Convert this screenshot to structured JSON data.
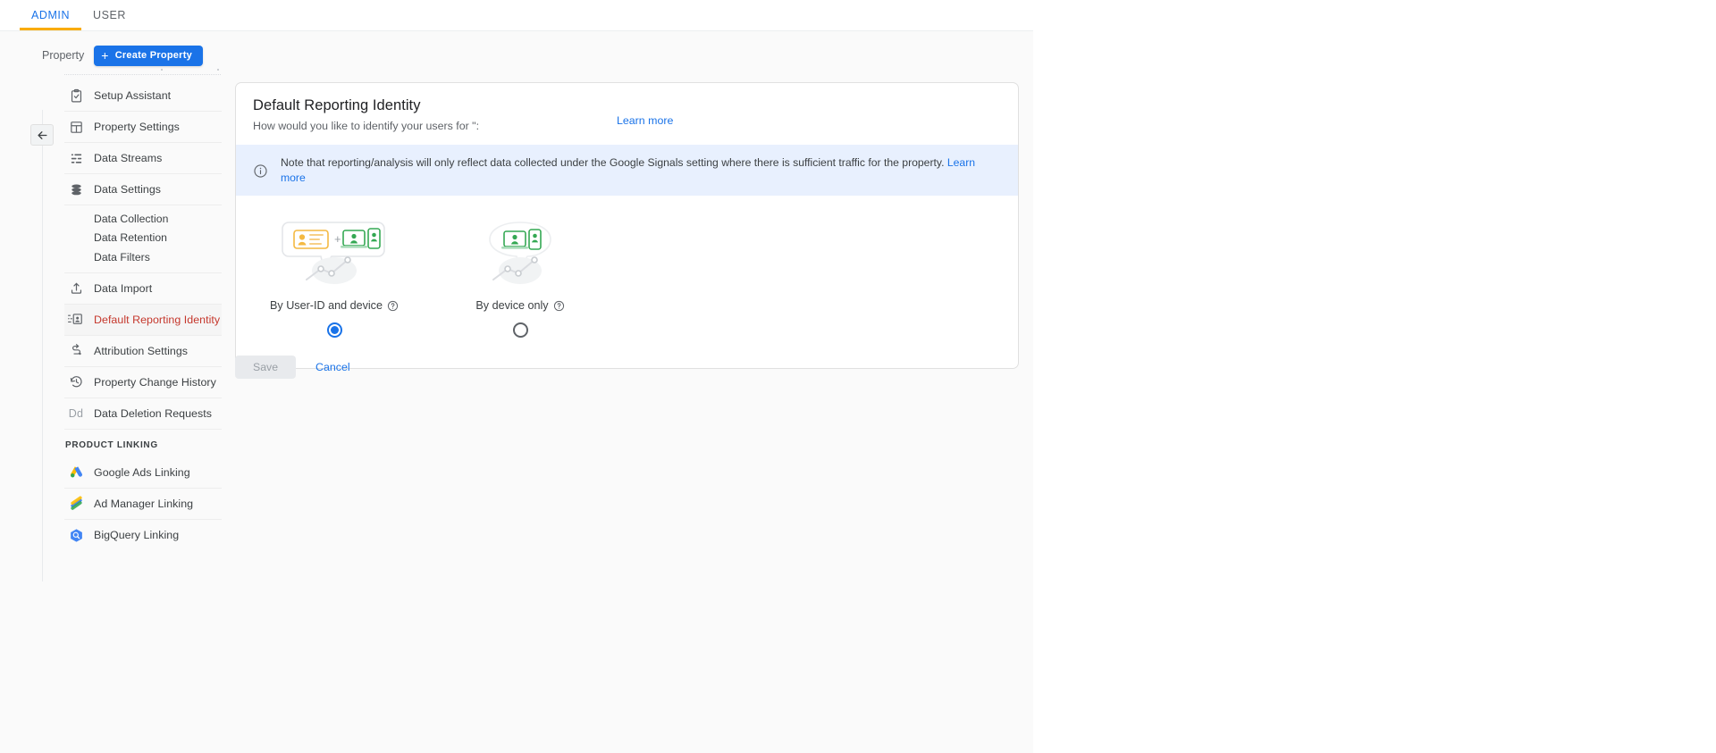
{
  "tabs": [
    {
      "label": "ADMIN",
      "active": true
    },
    {
      "label": "USER",
      "active": false
    }
  ],
  "property_bar": {
    "label": "Property",
    "create_button": "Create Property",
    "plus": "+"
  },
  "back_button": {
    "name": "back-arrow",
    "glyph": "←"
  },
  "sidebar": {
    "items": [
      {
        "label": "Setup Assistant",
        "icon": "clipboard-check-icon"
      },
      {
        "label": "Property Settings",
        "icon": "layout-icon"
      },
      {
        "label": "Data Streams",
        "icon": "data-streams-icon"
      },
      {
        "label": "Data Settings",
        "icon": "database-icon"
      }
    ],
    "sub_items": [
      {
        "label": "Data Collection"
      },
      {
        "label": "Data Retention"
      },
      {
        "label": "Data Filters"
      }
    ],
    "items2": [
      {
        "label": "Data Import",
        "icon": "upload-icon",
        "active": false
      },
      {
        "label": "Default Reporting Identity",
        "icon": "reporting-identity-icon",
        "active": true
      },
      {
        "label": "Attribution Settings",
        "icon": "attribution-icon",
        "active": false
      },
      {
        "label": "Property Change History",
        "icon": "history-icon",
        "active": false
      },
      {
        "label": "Data Deletion Requests",
        "icon": "dd-icon",
        "active": false
      }
    ],
    "section_title": "PRODUCT LINKING",
    "linking": [
      {
        "label": "Google Ads Linking",
        "icon": "google-ads-icon"
      },
      {
        "label": "Ad Manager Linking",
        "icon": "ad-manager-icon"
      },
      {
        "label": "BigQuery Linking",
        "icon": "bigquery-icon"
      }
    ]
  },
  "card": {
    "title": "Default Reporting Identity",
    "subtitle": "How would you like to identify your users for \":",
    "learn_more": "Learn more",
    "note": {
      "text": "Note that reporting/analysis will only reflect data collected under the Google Signals setting where there is sufficient traffic for the property.",
      "link": "Learn more"
    },
    "options": [
      {
        "label": "By User-ID and device",
        "selected": true,
        "illustration": "user-id-and-device-illustration"
      },
      {
        "label": "By device only",
        "selected": false,
        "illustration": "device-only-illustration"
      }
    ]
  },
  "actions": {
    "save": "Save",
    "cancel": "Cancel"
  },
  "colors": {
    "accent_blue": "#1a73e8",
    "tab_underline": "#f9ab00",
    "active_nav_text": "#c5372c",
    "note_bg": "#e8f0fe"
  }
}
